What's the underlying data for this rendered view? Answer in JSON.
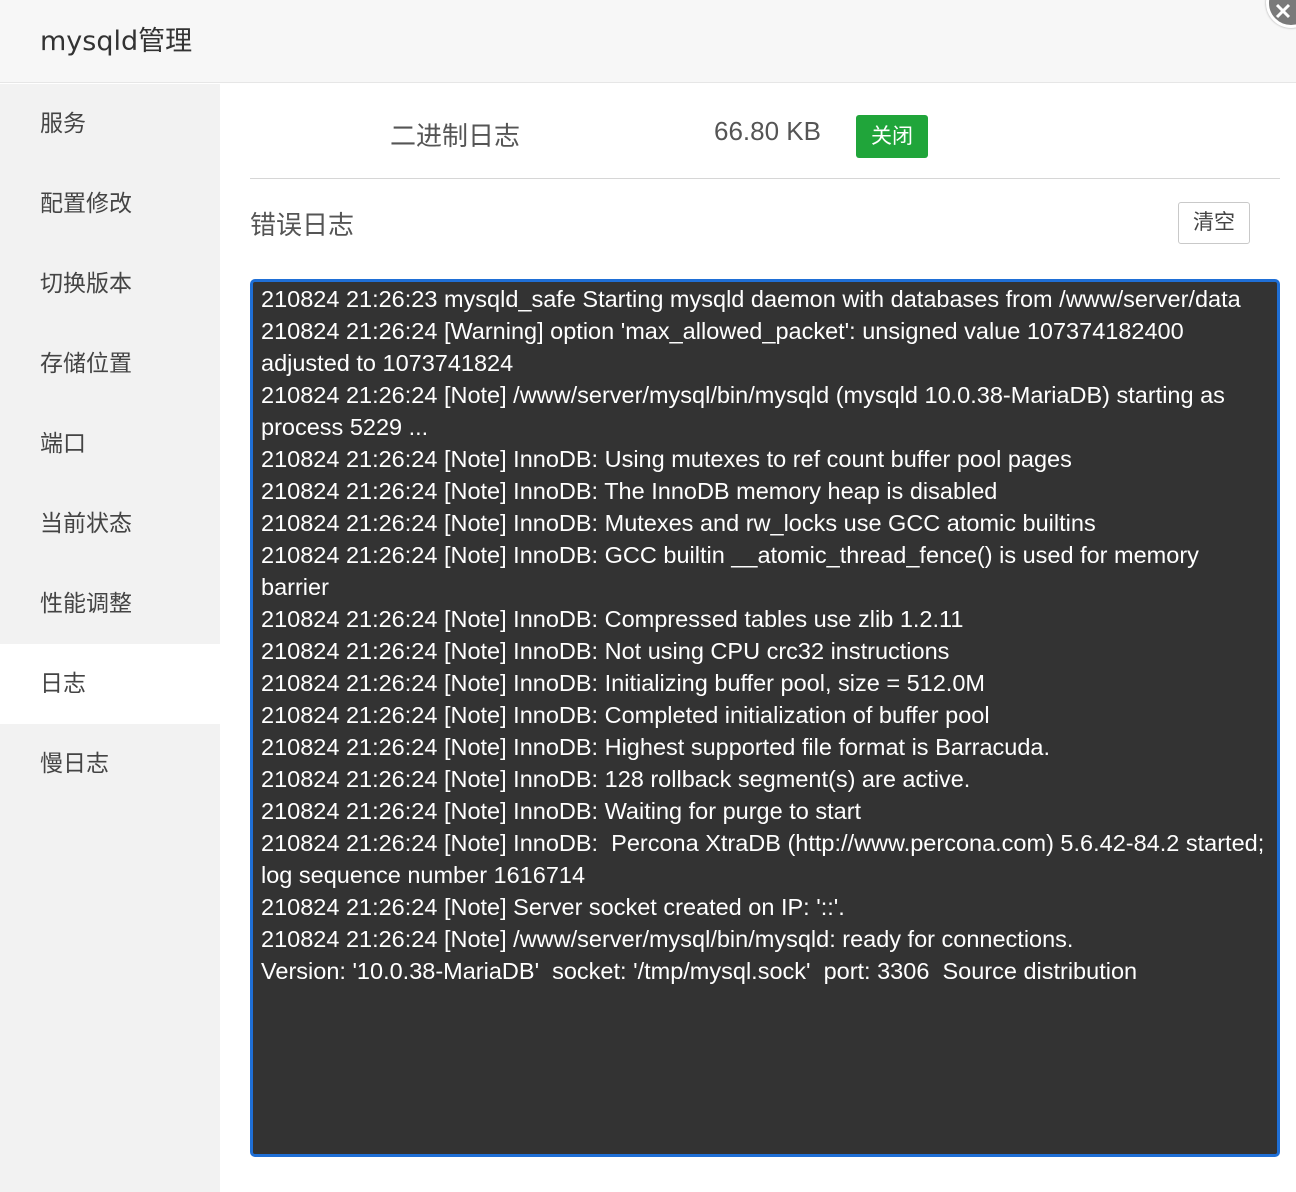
{
  "window": {
    "title": "mysqld管理"
  },
  "sidebar": {
    "items": [
      {
        "label": "服务"
      },
      {
        "label": "配置修改"
      },
      {
        "label": "切换版本"
      },
      {
        "label": "存储位置"
      },
      {
        "label": "端口"
      },
      {
        "label": "当前状态"
      },
      {
        "label": "性能调整"
      },
      {
        "label": "日志"
      },
      {
        "label": "慢日志"
      }
    ],
    "active_index": 7
  },
  "binlog": {
    "label": "二进制日志",
    "size": "66.80 KB",
    "button_label": "关闭",
    "button_color": "#20a53a"
  },
  "errorlog": {
    "label": "错误日志",
    "clear_label": "清空",
    "lines": [
      "210824 21:26:23 mysqld_safe Starting mysqld daemon with databases from /www/server/data",
      "210824 21:26:24 [Warning] option 'max_allowed_packet': unsigned value 107374182400 adjusted to 1073741824",
      "210824 21:26:24 [Note] /www/server/mysql/bin/mysqld (mysqld 10.0.38-MariaDB) starting as process 5229 ...",
      "210824 21:26:24 [Note] InnoDB: Using mutexes to ref count buffer pool pages",
      "210824 21:26:24 [Note] InnoDB: The InnoDB memory heap is disabled",
      "210824 21:26:24 [Note] InnoDB: Mutexes and rw_locks use GCC atomic builtins",
      "210824 21:26:24 [Note] InnoDB: GCC builtin __atomic_thread_fence() is used for memory barrier",
      "210824 21:26:24 [Note] InnoDB: Compressed tables use zlib 1.2.11",
      "210824 21:26:24 [Note] InnoDB: Not using CPU crc32 instructions",
      "210824 21:26:24 [Note] InnoDB: Initializing buffer pool, size = 512.0M",
      "210824 21:26:24 [Note] InnoDB: Completed initialization of buffer pool",
      "210824 21:26:24 [Note] InnoDB: Highest supported file format is Barracuda.",
      "210824 21:26:24 [Note] InnoDB: 128 rollback segment(s) are active.",
      "210824 21:26:24 [Note] InnoDB: Waiting for purge to start",
      "210824 21:26:24 [Note] InnoDB:  Percona XtraDB (http://www.percona.com) 5.6.42-84.2 started; log sequence number 1616714",
      "210824 21:26:24 [Note] Server socket created on IP: '::'.",
      "210824 21:26:24 [Note] /www/server/mysql/bin/mysqld: ready for connections.",
      "Version: '10.0.38-MariaDB'  socket: '/tmp/mysql.sock'  port: 3306  Source distribution"
    ],
    "box_border_color": "#1f6fd6",
    "box_background": "#333333"
  }
}
